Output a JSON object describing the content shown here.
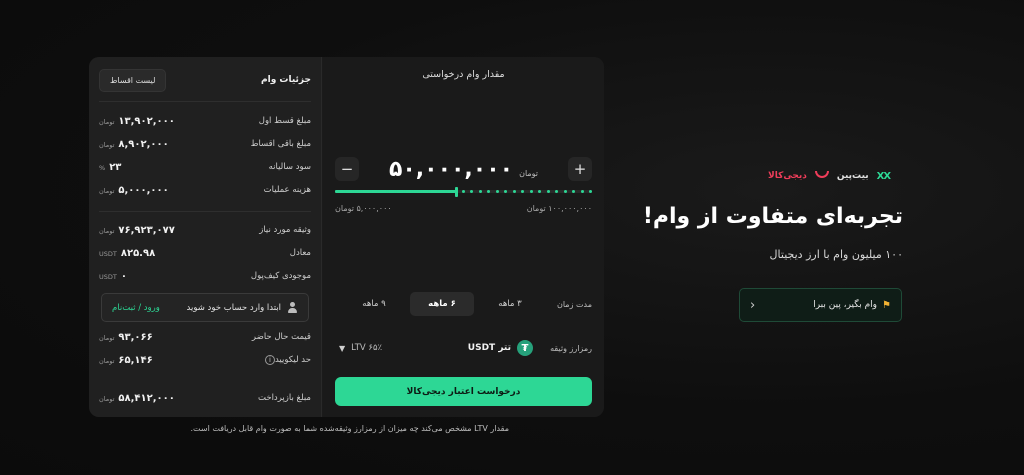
{
  "hero": {
    "brands": {
      "digikala": "دیجی‌کالا",
      "bitpin": "بیت‌پین",
      "xx": "XX"
    },
    "title": "تجربه‌ای متفاوت از وام!",
    "subtitle": "۱۰۰ میلیون وام با ارز دیجیتال",
    "cta_label": "وام بگیر، پین ببرا",
    "cta_icon": "trophy-icon"
  },
  "details": {
    "title": "جزئیات وام",
    "installments_button": "لیست اقساط",
    "rows1": [
      {
        "label": "مبلغ قسط اول",
        "value": "۱۳,۹۰۲,۰۰۰",
        "unit": "تومان"
      },
      {
        "label": "مبلغ باقی اقساط",
        "value": "۸,۹۰۲,۰۰۰",
        "unit": "تومان"
      },
      {
        "label": "سود سالیانه",
        "value": "۲۳",
        "unit": "%"
      },
      {
        "label": "هزینه عملیات",
        "value": "۵,۰۰۰,۰۰۰",
        "unit": "تومان"
      }
    ],
    "rows2": [
      {
        "label": "وثیقه مورد نیاز",
        "value": "۷۶,۹۲۳,۰۷۷",
        "unit": "تومان"
      },
      {
        "label": "معادل",
        "value": "۸۲۵.۹۸",
        "unit": "USDT"
      },
      {
        "label": "موجودی کیف‌پول",
        "value": "۰",
        "unit": "USDT"
      }
    ],
    "login": {
      "message": "ابتدا وارد حساب خود شوید",
      "link": "ورود / ثبت‌نام"
    },
    "rows3": [
      {
        "label": "قیمت حال حاضر",
        "value": "۹۳,۰۶۶",
        "unit": "تومان"
      },
      {
        "label": "حد لیکویید",
        "value": "۶۵,۱۴۶",
        "unit": "تومان"
      },
      {
        "label": "مبلغ بازپرداخت",
        "value": "۵۸,۴۱۲,۰۰۰",
        "unit": "تومان"
      }
    ]
  },
  "request": {
    "title": "مقدار وام درخواستی",
    "amount": "۵۰,۰۰۰,۰۰۰",
    "amount_unit": "تومان",
    "minus": "−",
    "plus": "+",
    "slider_position": 0.47,
    "min_label": "۵,۰۰۰,۰۰۰ تومان",
    "max_label": "۱۰۰,۰۰۰,۰۰۰ تومان",
    "period_label": "مدت زمان",
    "periods": [
      "۳ ماهه",
      "۶ ماهه",
      "۹ ماهه"
    ],
    "active_period": 1,
    "collateral_label": "رمزارز وثیقه",
    "coin": "تتر USDT",
    "ltv": "LTV ۶۵٪",
    "submit": "درخواست اعتبار دیجی‌کالا"
  },
  "footnote": "مقدار LTV مشخص می‌کند چه میزان از رمزارز وثیقه‌شده شما به صورت وام قابل دریافت است.",
  "colors": {
    "accent": "#2dd795",
    "background": "#0e0e0e",
    "brand_red": "#ef3d5a"
  }
}
